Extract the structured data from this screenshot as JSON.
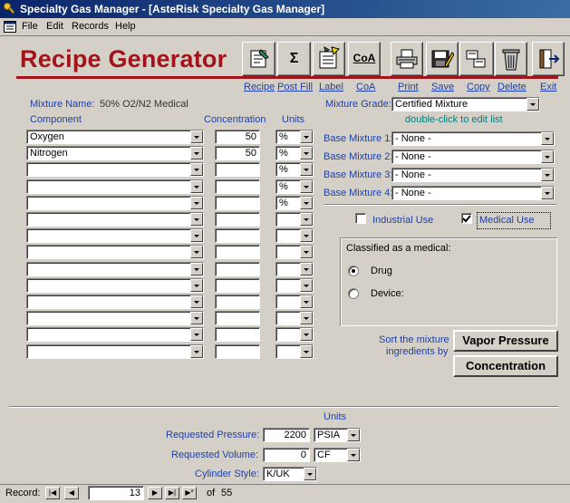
{
  "window": {
    "title": "Specialty Gas Manager - [AsteRisk Specialty Gas Manager]"
  },
  "menu": {
    "items": [
      "File",
      "Edit",
      "Records",
      "Help"
    ]
  },
  "header": {
    "title": "Recipe Generator"
  },
  "toolbar": {
    "labels": {
      "recipe": "Recipe",
      "post_fill": "Post Fill",
      "label": "Label",
      "coa": "CoA",
      "print": "Print",
      "save": "Save",
      "copy": "Copy",
      "delete": "Delete",
      "exit": "Exit"
    },
    "icons": [
      "recipe-icon",
      "sigma-icon",
      "label-icon",
      "coa-icon",
      "printer-icon",
      "save-icon",
      "copy-icon",
      "trash-icon",
      "exit-icon"
    ],
    "coa_glyph": "CoA",
    "sigma_glyph": "Σ"
  },
  "mixture": {
    "name_label": "Mixture Name:",
    "name_value": "50% O2/N2 Medical",
    "grade_label": "Mixture Grade:",
    "grade_value": "Certified Mixture",
    "hint": "double-click to edit list"
  },
  "columns": {
    "component": "Component",
    "concentration": "Concentration",
    "units": "Units"
  },
  "components": [
    {
      "name": "Oxygen",
      "conc": "50",
      "unit": "%"
    },
    {
      "name": "Nitrogen",
      "conc": "50",
      "unit": "%"
    },
    {
      "name": "",
      "conc": "",
      "unit": "%"
    },
    {
      "name": "",
      "conc": "",
      "unit": "%"
    },
    {
      "name": "",
      "conc": "",
      "unit": "%"
    },
    {
      "name": "",
      "conc": "",
      "unit": ""
    },
    {
      "name": "",
      "conc": "",
      "unit": ""
    },
    {
      "name": "",
      "conc": "",
      "unit": ""
    },
    {
      "name": "",
      "conc": "",
      "unit": ""
    },
    {
      "name": "",
      "conc": "",
      "unit": ""
    },
    {
      "name": "",
      "conc": "",
      "unit": ""
    },
    {
      "name": "",
      "conc": "",
      "unit": ""
    },
    {
      "name": "",
      "conc": "",
      "unit": ""
    },
    {
      "name": "",
      "conc": "",
      "unit": ""
    }
  ],
  "base_mixtures": [
    {
      "label": "Base Mixture 1:",
      "value": "- None -"
    },
    {
      "label": "Base Mixture 2:",
      "value": "- None -"
    },
    {
      "label": "Base Mixture 3:",
      "value": "- None -"
    },
    {
      "label": "Base Mixture 4:",
      "value": "- None -"
    }
  ],
  "use": {
    "industrial_label": "Industrial Use",
    "industrial_checked": false,
    "medical_label": "Medical Use",
    "medical_checked": true
  },
  "classification": {
    "title": "Classified as a medical:",
    "options": [
      "Drug",
      "Device:"
    ],
    "selected": "Drug"
  },
  "sort": {
    "label_line1": "Sort the mixture",
    "label_line2": "ingredients by",
    "vapor_button": "Vapor Pressure",
    "concentration_button": "Concentration"
  },
  "footer": {
    "units_heading": "Units",
    "pressure_label": "Requested Pressure:",
    "pressure_value": "2200",
    "pressure_unit": "PSIA",
    "volume_label": "Requested Volume:",
    "volume_value": "0",
    "volume_unit": "CF",
    "cylinder_label": "Cylinder Style:",
    "cylinder_value": "K/UK"
  },
  "record_nav": {
    "label": "Record:",
    "current": "13",
    "of_label": "of",
    "total": "55"
  },
  "colors": {
    "title_red": "#a3131a",
    "label_blue": "#1e3fa8",
    "hint_teal": "#008080",
    "titlebar": "#0a246a"
  }
}
